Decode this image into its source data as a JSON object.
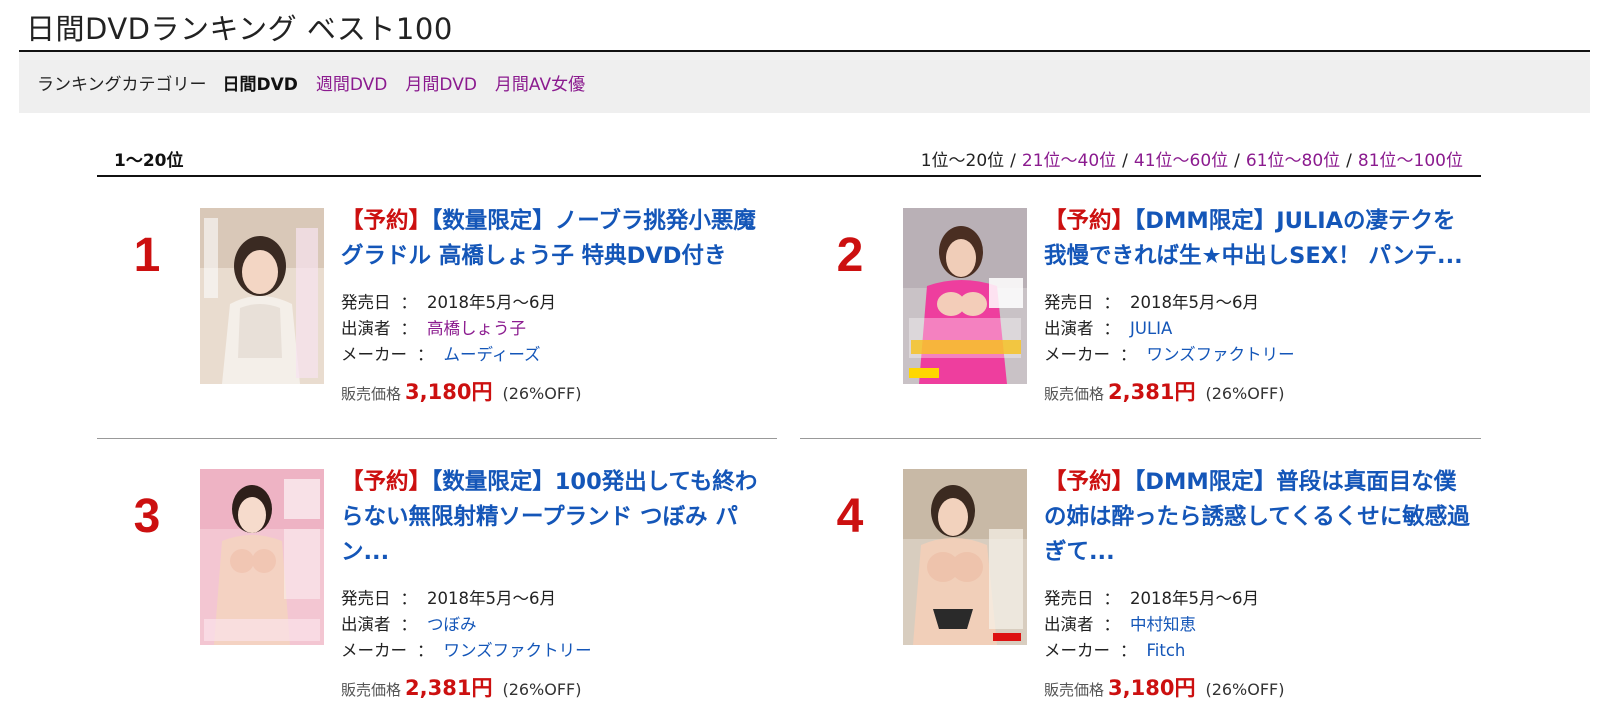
{
  "page": {
    "title": "日間DVDランキング ベスト100"
  },
  "categories": {
    "label": "ランキングカテゴリー",
    "items": [
      {
        "label": "日間DVD"
      },
      {
        "label": "週間DVD"
      },
      {
        "label": "月間DVD"
      },
      {
        "label": "月間AV女優"
      }
    ]
  },
  "range": {
    "current": "1〜20位",
    "pages": [
      "1位〜20位",
      "21位〜40位",
      "41位〜60位",
      "61位〜80位",
      "81位〜100位"
    ],
    "separator": "/"
  },
  "labels": {
    "release": "発売日",
    "performer": "出演者",
    "maker": "メーカー",
    "colon": "：",
    "price_label": "販売価格"
  },
  "items": [
    {
      "rank": "1",
      "tag": "【予約】",
      "title": "【数量限定】ノーブラ挑発小悪魔グラドル 高橋しょう子 特典DVD付き",
      "release": "2018年5月〜6月",
      "performer": "高橋しょう子",
      "maker": "ムーディーズ",
      "price": "3,180円",
      "discount": "(26%OFF)"
    },
    {
      "rank": "2",
      "tag": "【予約】",
      "title": "【DMM限定】JULIAの凄テクを我慢できれば生★中出しSEX！ パンテ...",
      "release": "2018年5月〜6月",
      "performer": "JULIA",
      "maker": "ワンズファクトリー",
      "price": "2,381円",
      "discount": "(26%OFF)"
    },
    {
      "rank": "3",
      "tag": "【予約】",
      "title": "【数量限定】100発出しても終わらない無限射精ソープランド つぼみ パン...",
      "release": "2018年5月〜6月",
      "performer": "つぼみ",
      "maker": "ワンズファクトリー",
      "price": "2,381円",
      "discount": "(26%OFF)"
    },
    {
      "rank": "4",
      "tag": "【予約】",
      "title": "【DMM限定】普段は真面目な僕の姉は酔ったら誘惑してくるくせに敏感過ぎて...",
      "release": "2018年5月〜6月",
      "performer": "中村知恵",
      "maker": "Fitch",
      "price": "3,180円",
      "discount": "(26%OFF)"
    }
  ],
  "colors": {
    "accent_red": "#cc1010",
    "link_blue": "#1456b8",
    "link_purple": "#8b1b8f",
    "bar_gray": "#efefef"
  }
}
